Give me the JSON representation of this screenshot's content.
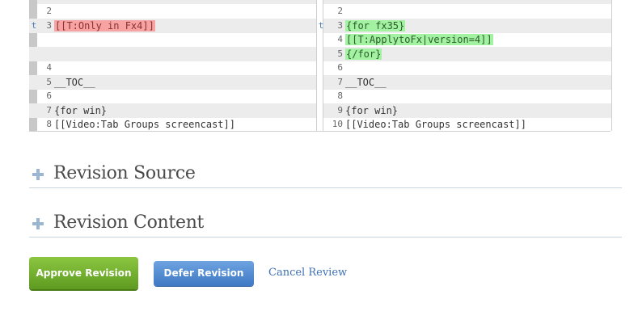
{
  "diff": {
    "left": [
      {
        "mark": "",
        "num": "2",
        "code": "",
        "alt": false
      },
      {
        "mark": "t",
        "num": "3",
        "code": "[[T:Only in Fx4]]",
        "change": "del",
        "alt": true
      },
      {
        "mark": "",
        "num": "",
        "code": "",
        "alt": false
      },
      {
        "mark": "",
        "num": "",
        "code": "",
        "alt": true
      },
      {
        "mark": "",
        "num": "4",
        "code": "",
        "alt": false
      },
      {
        "mark": "",
        "num": "5",
        "code": "__TOC__",
        "alt": true
      },
      {
        "mark": "",
        "num": "6",
        "code": "",
        "alt": false
      },
      {
        "mark": "",
        "num": "7",
        "code": "{for win}",
        "alt": true
      },
      {
        "mark": "",
        "num": "8",
        "code": "[[Video:Tab Groups screencast]]",
        "alt": false
      }
    ],
    "right": [
      {
        "mark": "",
        "num": "2",
        "code": "",
        "alt": false
      },
      {
        "mark": "t",
        "num": "3",
        "code": "{for fx35}",
        "change": "add",
        "alt": true
      },
      {
        "mark": "",
        "num": "4",
        "code": "[[T:ApplytoFx|version=4]]",
        "change": "add",
        "alt": false
      },
      {
        "mark": "",
        "num": "5",
        "code": "{/for}",
        "change": "add",
        "alt": true
      },
      {
        "mark": "",
        "num": "6",
        "code": "",
        "alt": false
      },
      {
        "mark": "",
        "num": "7",
        "code": "__TOC__",
        "alt": true
      },
      {
        "mark": "",
        "num": "8",
        "code": "",
        "alt": false
      },
      {
        "mark": "",
        "num": "9",
        "code": "{for win}",
        "alt": true
      },
      {
        "mark": "",
        "num": "10",
        "code": "[[Video:Tab Groups screencast]]",
        "alt": false
      }
    ]
  },
  "sections": {
    "source_title": "Revision Source",
    "content_title": "Revision Content"
  },
  "actions": {
    "approve_label": "Approve Revision",
    "defer_label": "Defer Revision",
    "cancel_label": "Cancel Review"
  },
  "colors": {
    "deleted": "#f8a3a3",
    "added": "#a2f2a2",
    "approve": "#6fae2c",
    "defer": "#4f86d0",
    "link": "#3c6fb5"
  }
}
